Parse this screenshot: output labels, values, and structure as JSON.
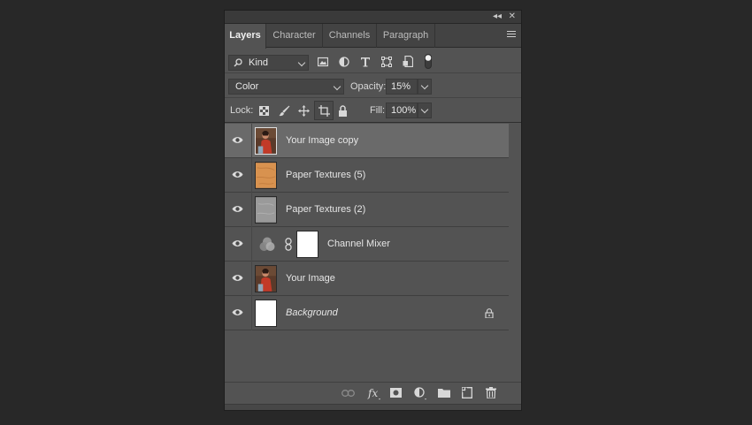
{
  "panel": {
    "collapse_glyph": "◂◂",
    "close_glyph": "✕",
    "tabs": [
      {
        "label": "Layers",
        "active": true
      },
      {
        "label": "Character",
        "active": false
      },
      {
        "label": "Channels",
        "active": false
      },
      {
        "label": "Paragraph",
        "active": false
      }
    ]
  },
  "filter": {
    "kind_label": "Kind",
    "icons": [
      "pixel-filter-icon",
      "adjustment-filter-icon",
      "type-filter-icon",
      "shape-filter-icon",
      "smart-object-filter-icon",
      "filter-toggle"
    ]
  },
  "blend": {
    "mode": "Color",
    "opacity_label": "Opacity:",
    "opacity_value": "15%"
  },
  "lock": {
    "label": "Lock:",
    "fill_label": "Fill:",
    "fill_value": "100%"
  },
  "layers": [
    {
      "name": "Your Image copy",
      "selected": true,
      "thumb": "photo",
      "italic": false
    },
    {
      "name": "Paper Textures (5)",
      "selected": false,
      "thumb": "paper-orange",
      "italic": false
    },
    {
      "name": "Paper Textures (2)",
      "selected": false,
      "thumb": "paper-gray",
      "italic": false
    },
    {
      "name": "Channel Mixer",
      "selected": false,
      "thumb": "adjustment",
      "italic": false
    },
    {
      "name": "Your Image",
      "selected": false,
      "thumb": "photo",
      "italic": false
    },
    {
      "name": "Background",
      "selected": false,
      "thumb": "white",
      "italic": true,
      "locked": true
    }
  ],
  "colors": {
    "panel_bg": "#535353",
    "selected_row": "#6a6a6a",
    "app_bg": "#282828"
  }
}
